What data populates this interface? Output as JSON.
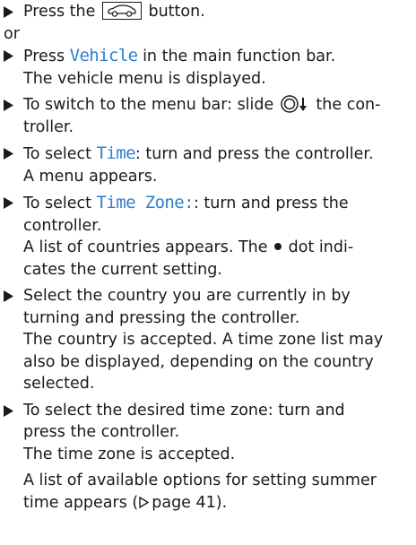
{
  "steps": {
    "s1": {
      "before": "Press the ",
      "icon": "car-icon",
      "after": " button."
    },
    "or": "or",
    "s2": {
      "before": "Press ",
      "highlight": "Vehicle",
      "after": " in the main function bar.",
      "line2": "The vehicle menu is displayed."
    },
    "s3": {
      "before": "To switch to the menu bar: slide ",
      "icon": "controller-slide-down-icon",
      "after": " the con-",
      "line2": "troller."
    },
    "s4": {
      "before": "To select ",
      "highlight": "Time",
      "after": ": turn and press the controller.",
      "line2": "A menu appears."
    },
    "s5": {
      "before": "To select ",
      "highlight": "Time Zone:",
      "after": ": turn and press the",
      "line2": "controller.",
      "line3_before": "A list of countries appears. The ",
      "dot_icon": "dot-icon",
      "line3_after": " dot indi-",
      "line4": "cates the current setting."
    },
    "s6": {
      "line1": "Select the country you are currently in by",
      "line2": "turning and pressing the controller.",
      "line3": "The country is accepted. A time zone list may",
      "line4": "also be displayed, depending on the country",
      "line5": "selected."
    },
    "s7": {
      "line1": "To select the desired time zone: turn and",
      "line2": "press the controller.",
      "line3": "The time zone is accepted.",
      "line4": "A list of available options for setting summer",
      "line5_before": "time appears (",
      "page_ref_icon": "page-reference-arrow-icon",
      "line5_after": "page 41)."
    }
  },
  "colors": {
    "text": "#1a1a1a",
    "highlight": "#2f7fd0"
  }
}
